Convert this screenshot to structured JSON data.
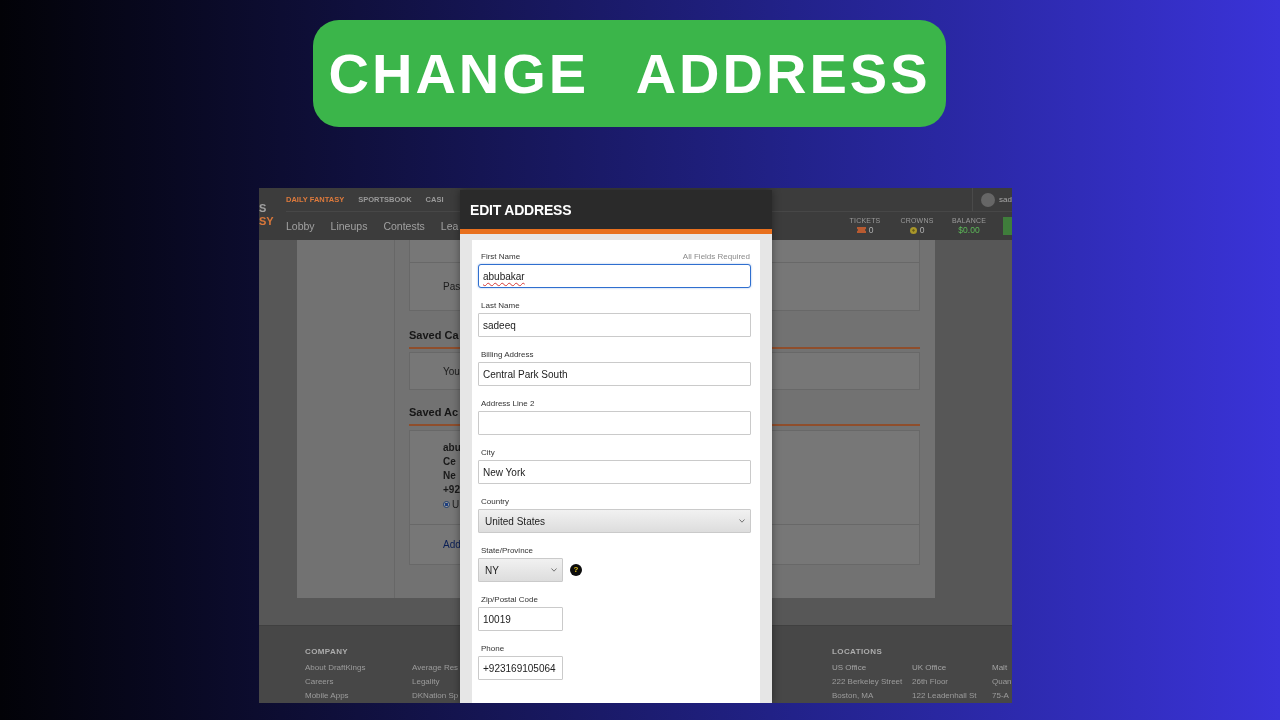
{
  "banner": {
    "title": "CHANGE ADDRESS"
  },
  "screenshot": {
    "site_header": {
      "logo": [
        {
          "text": "S",
          "accent": false
        },
        {
          "text": "SY",
          "accent": true
        }
      ],
      "product_tabs": [
        {
          "label": "DAILY FANTASY",
          "selected": true
        },
        {
          "label": "SPORTSBOOK",
          "selected": false
        },
        {
          "label": "CASI",
          "selected": false
        }
      ],
      "user": "sad",
      "nav": [
        "Lobby",
        "Lineups",
        "Contests",
        "Lea"
      ],
      "stats": [
        {
          "kind": "tickets",
          "label": "TICKETS",
          "value": "0"
        },
        {
          "kind": "crowns",
          "label": "CROWNS",
          "value": "0"
        },
        {
          "kind": "balance",
          "label": "BALANCE",
          "value": "$0.00"
        }
      ]
    },
    "account_page": [
      {
        "kind": "card",
        "text": "Pas"
      },
      {
        "kind": "heading",
        "text": "Saved Ca"
      },
      {
        "kind": "card",
        "text": "You"
      },
      {
        "kind": "heading",
        "text": "Saved Ac"
      },
      {
        "kind": "address",
        "lines": [
          "abu",
          "Ce",
          "Ne",
          "+92"
        ],
        "option": {
          "label": "U",
          "selected": true
        }
      },
      {
        "kind": "link",
        "text": "Add"
      }
    ],
    "footer": {
      "columns": [
        {
          "heading": "COMPANY",
          "links": [
            "About DraftKings",
            "Careers",
            "Mobile Apps"
          ]
        },
        {
          "links": [
            "Average Res",
            "Legality",
            "DKNation Sp"
          ]
        }
      ],
      "locations": {
        "heading": "LOCATIONS",
        "offices": [
          {
            "name": "US Office",
            "lines": [
              "222 Berkeley Street",
              "Boston, MA"
            ]
          },
          {
            "name": "UK Office",
            "lines": [
              "26th Floor",
              "122 Leadenhall St"
            ]
          },
          {
            "name": "Malt",
            "lines": [
              "Quan",
              "75-A"
            ]
          }
        ]
      }
    },
    "modal": {
      "title": "EDIT ADDRESS",
      "note": "All Fields Required",
      "fields": [
        {
          "label": "First Name",
          "kind": "text",
          "value": "abubakar",
          "focused": true,
          "misspelled": true,
          "short": false
        },
        {
          "label": "Last Name",
          "kind": "text",
          "value": "sadeeq",
          "focused": false,
          "misspelled": false,
          "short": false
        },
        {
          "label": "Billing Address",
          "kind": "text",
          "value": "Central Park South",
          "focused": false,
          "misspelled": false,
          "short": false
        },
        {
          "label": "Address Line 2",
          "kind": "text",
          "focused": false,
          "short": false
        },
        {
          "label": "City",
          "kind": "text",
          "value": "New York",
          "focused": false,
          "misspelled": false,
          "short": false
        },
        {
          "label": "Country",
          "kind": "select",
          "value": "United States",
          "focused": false,
          "misspelled": false,
          "short": false
        },
        {
          "label": "State/Province",
          "kind": "select",
          "value": "NY",
          "focused": false,
          "misspelled": false,
          "short": true,
          "help": "?"
        },
        {
          "label": "Zip/Postal Code",
          "kind": "text",
          "value": "10019",
          "focused": false,
          "misspelled": false,
          "short": true
        },
        {
          "label": "Phone",
          "kind": "text",
          "value": "+923169105064",
          "focused": false,
          "misspelled": false,
          "short": true
        }
      ]
    }
  }
}
